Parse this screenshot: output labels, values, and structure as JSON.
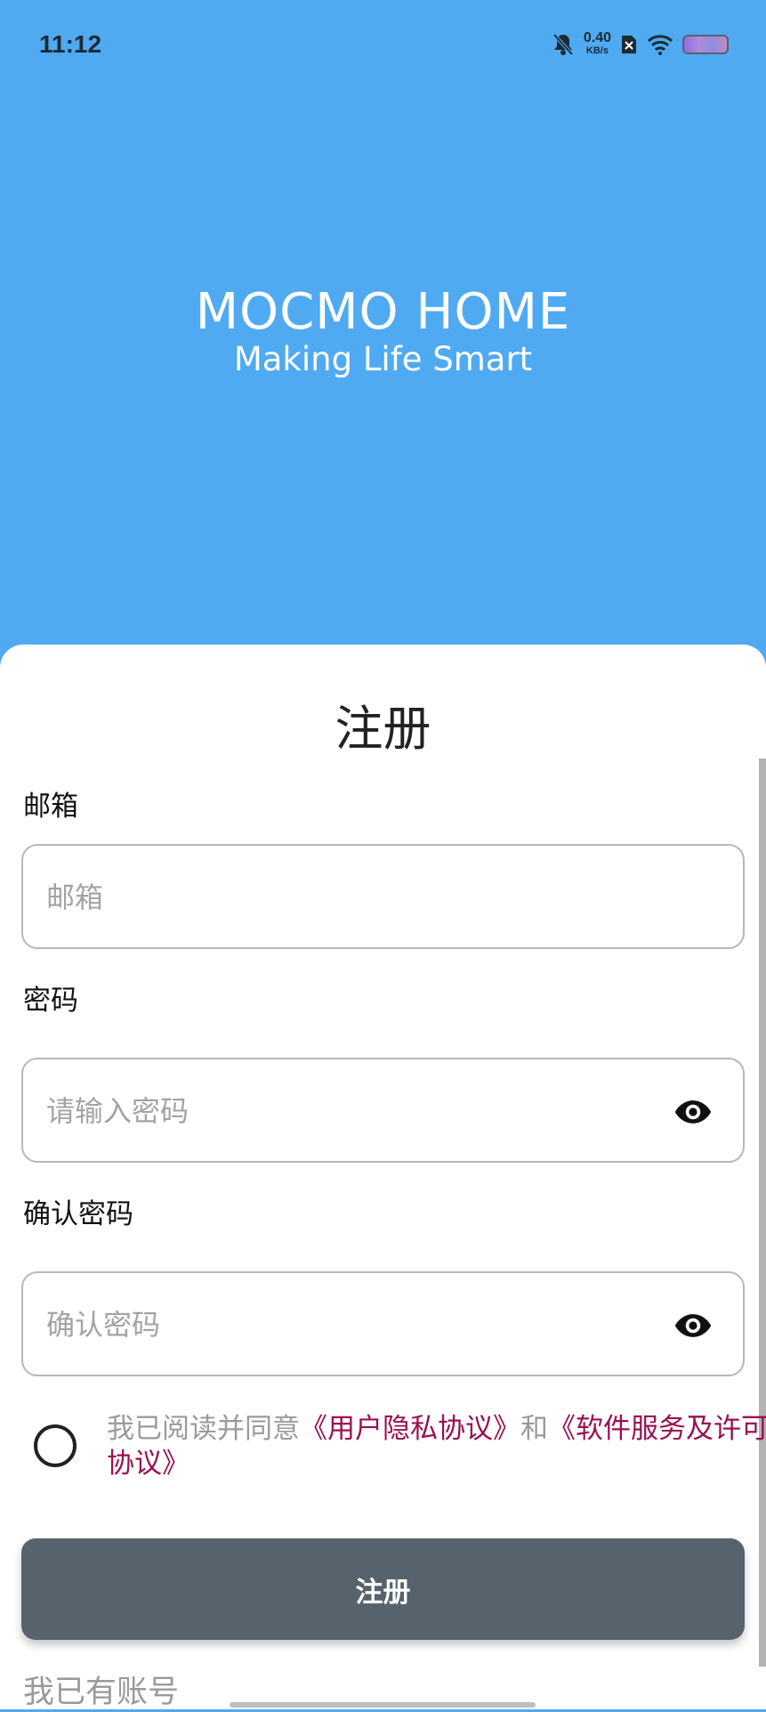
{
  "status_bar": {
    "time": "11:12",
    "net_speed": "0.40",
    "net_speed_unit": "KB/s",
    "icons": [
      "bell-muted-icon",
      "sim-off-icon",
      "wifi-icon",
      "battery-icon"
    ]
  },
  "brand": {
    "title": "MOCMO HOME",
    "subtitle": "Making Life Smart"
  },
  "form": {
    "title": "注册",
    "email_label": "邮箱",
    "email_placeholder": "邮箱",
    "password_label": "密码",
    "password_placeholder": "请输入密码",
    "confirm_label": "确认密码",
    "confirm_placeholder": "确认密码",
    "agree_prefix": "我已阅读并同意",
    "privacy_link": "《用户隐私协议》",
    "agree_and": "和",
    "license_link": "《软件服务及许可协议》",
    "submit_label": "注册",
    "login_link": "我已有账号"
  },
  "colors": {
    "header_bg": "#4faaf2",
    "button_bg": "#56636c",
    "link": "#9a1050"
  }
}
